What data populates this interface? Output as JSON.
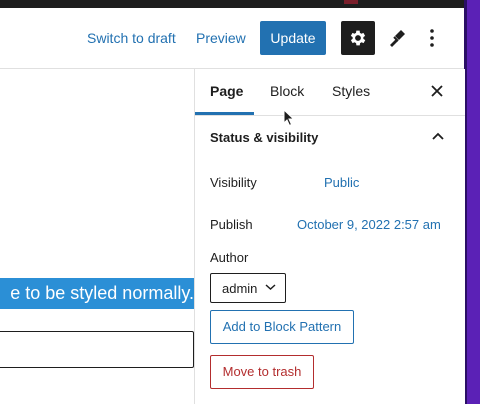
{
  "header": {
    "switch_to_draft": "Switch to draft",
    "preview": "Preview",
    "update": "Update",
    "icons": [
      "gear-icon",
      "brush-icon",
      "more-vertical-icon"
    ]
  },
  "editor": {
    "highlighted_text": "e to be styled normally."
  },
  "sidebar": {
    "tabs": [
      {
        "label": "Page",
        "active": true
      },
      {
        "label": "Block",
        "active": false
      },
      {
        "label": "Styles",
        "active": false
      }
    ],
    "panel": {
      "title": "Status & visibility",
      "visibility_label": "Visibility",
      "visibility_value": "Public",
      "publish_label": "Publish",
      "publish_value": "October 9, 2022 2:57 am",
      "author_label": "Author",
      "author_value": "admin",
      "add_pattern": "Add to Block Pattern",
      "move_trash": "Move to trash"
    }
  },
  "colors": {
    "accent": "#2271b1",
    "danger": "#b32d2e",
    "highlight": "#2b8fd6",
    "dark": "#1e1e1e",
    "frame": "#5b21b6"
  }
}
